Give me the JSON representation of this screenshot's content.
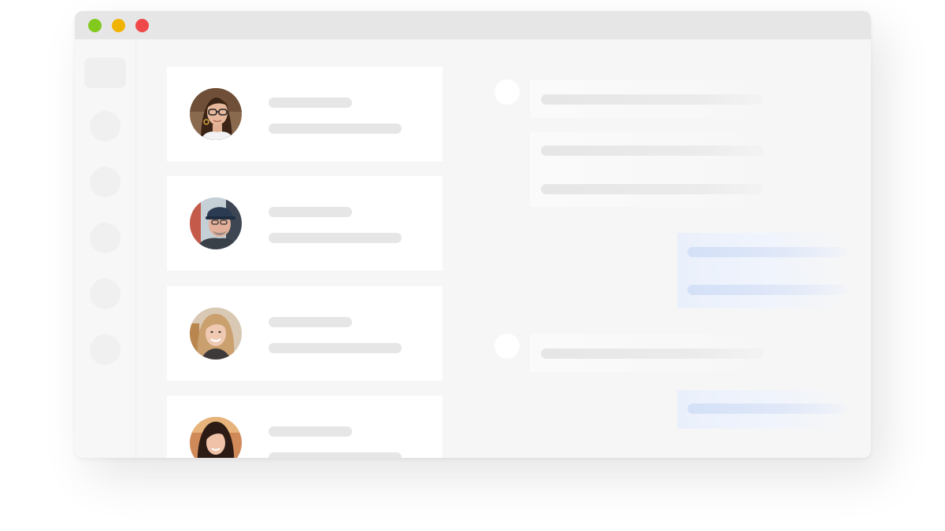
{
  "window": {
    "controls": [
      {
        "name": "zoom",
        "color": "#82c91e"
      },
      {
        "name": "minimize",
        "color": "#f0b400"
      },
      {
        "name": "close",
        "color": "#f04848"
      }
    ]
  },
  "contacts": [
    {
      "avatar": "woman-with-glasses-avatar"
    },
    {
      "avatar": "man-with-cap-avatar"
    },
    {
      "avatar": "blonde-woman-avatar"
    },
    {
      "avatar": "dark-haired-woman-avatar"
    }
  ],
  "colors": {
    "window_bg": "#f6f6f6",
    "titlebar": "#e6e6e6",
    "placeholder_gray": "#e6e6e6",
    "placeholder_blue": "#d3e0f7"
  }
}
